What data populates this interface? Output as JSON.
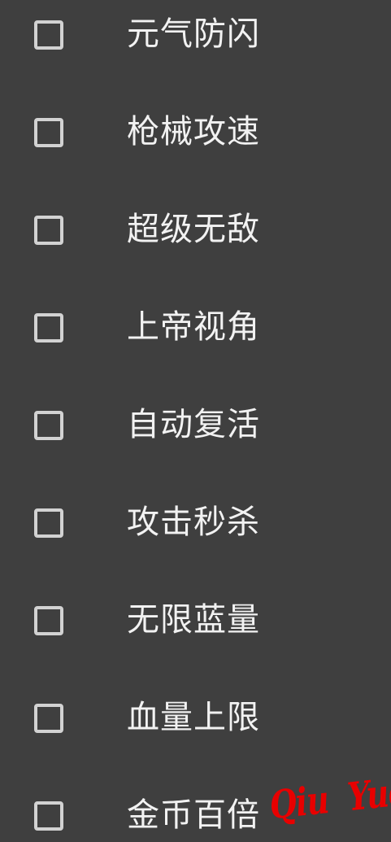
{
  "options": [
    {
      "label": "元气防闪",
      "checked": false
    },
    {
      "label": "枪械攻速",
      "checked": false
    },
    {
      "label": "超级无敌",
      "checked": false
    },
    {
      "label": "上帝视角",
      "checked": false
    },
    {
      "label": "自动复活",
      "checked": false
    },
    {
      "label": "攻击秒杀",
      "checked": false
    },
    {
      "label": "无限蓝量",
      "checked": false
    },
    {
      "label": "血量上限",
      "checked": false
    },
    {
      "label": "金币百倍",
      "checked": false
    }
  ],
  "watermark": "Qiu  Yue",
  "colors": {
    "background": "#3f3f3f",
    "checkbox_border": "#d2d2d2",
    "label_text": "#f2f2f2",
    "watermark": "#e80000"
  }
}
